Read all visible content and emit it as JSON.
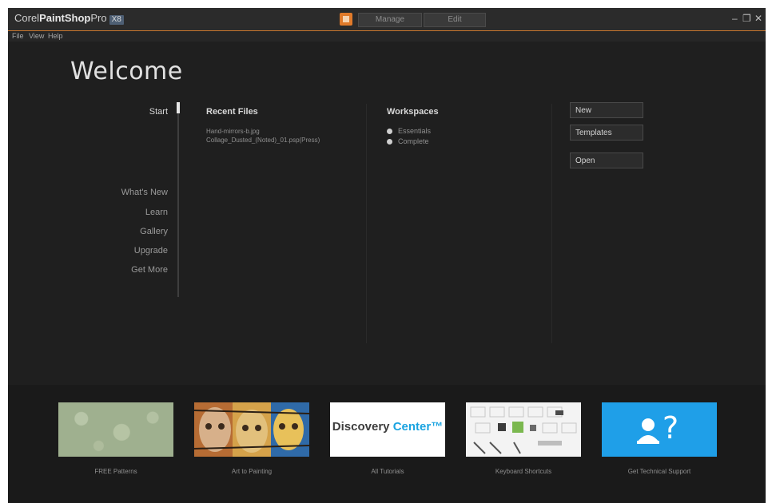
{
  "app": {
    "logo_prefix": "Corel",
    "logo_main": "PaintShop",
    "logo_suffix": "Pro",
    "logo_version": "X8"
  },
  "workspace_tabs": [
    {
      "label": "Manage"
    },
    {
      "label": "Edit"
    }
  ],
  "window_controls": [
    "–",
    "❐",
    "✕"
  ],
  "menu": [
    "File",
    "View",
    "Help"
  ],
  "welcome": {
    "title": "Welcome",
    "nav": {
      "start": "Start",
      "items": [
        "What's New",
        "Learn",
        "Gallery",
        "Upgrade",
        "Get More"
      ]
    },
    "recent": {
      "title": "Recent Files",
      "items": [
        "Hand-mirrors-b.jpg",
        "Collage_Dusted_(Noted)_01.psp(Press)"
      ]
    },
    "workspaces": {
      "title": "Workspaces",
      "options": [
        "Essentials",
        "Complete"
      ]
    },
    "actions": {
      "new": "New",
      "templates": "Templates",
      "open": "Open"
    }
  },
  "tiles": [
    {
      "label": "FREE Patterns"
    },
    {
      "label": "Art to Painting"
    },
    {
      "label": "All Tutorials",
      "brand": "Discovery",
      "brand_accent": "Center",
      "brand_mark": "™"
    },
    {
      "label": "Keyboard Shortcuts"
    },
    {
      "label": "Get Technical Support",
      "glyph": "?"
    }
  ],
  "colors": {
    "accent": "#c8772e",
    "background": "#1f1f1f",
    "support_blue": "#1f9fe8"
  }
}
